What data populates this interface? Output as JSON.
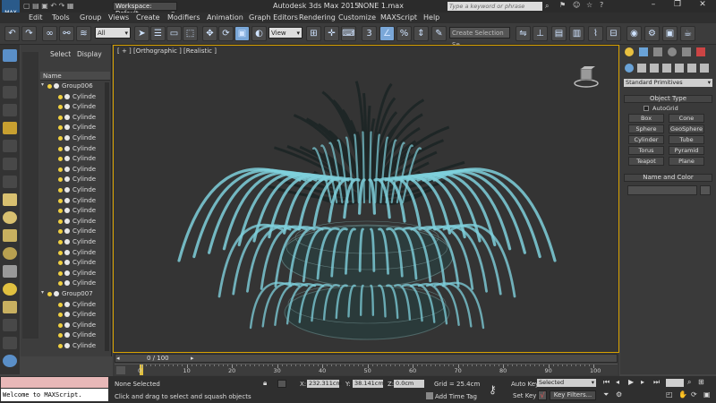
{
  "title": {
    "workspace": "Workspace: Default",
    "app_title": "Autodesk 3ds Max  2015",
    "file_name": "NONE 1.max",
    "search_placeholder": "Type a keyword or phrase"
  },
  "menu": [
    "Edit",
    "Tools",
    "Group",
    "Views",
    "Create",
    "Modifiers",
    "Animation",
    "Graph Editors",
    "Rendering",
    "Customize",
    "MAXScript",
    "Help"
  ],
  "toolbar": {
    "selection_filter": "All",
    "reference_coord": "View",
    "selection_set_placeholder": "Create Selection Se"
  },
  "scene_explorer": {
    "tabs": [
      "Select",
      "Display"
    ],
    "column_header": "Name",
    "items": [
      {
        "label": "Group006",
        "level": 0
      },
      {
        "label": "Cylinde",
        "level": 1
      },
      {
        "label": "Cylinde",
        "level": 1
      },
      {
        "label": "Cylinde",
        "level": 1
      },
      {
        "label": "Cylinde",
        "level": 1
      },
      {
        "label": "Cylinde",
        "level": 1
      },
      {
        "label": "Cylinde",
        "level": 1
      },
      {
        "label": "Cylinde",
        "level": 1
      },
      {
        "label": "Cylinde",
        "level": 1
      },
      {
        "label": "Cylinde",
        "level": 1
      },
      {
        "label": "Cylinde",
        "level": 1
      },
      {
        "label": "Cylinde",
        "level": 1
      },
      {
        "label": "Cylinde",
        "level": 1
      },
      {
        "label": "Cylinde",
        "level": 1
      },
      {
        "label": "Cylinde",
        "level": 1
      },
      {
        "label": "Cylinde",
        "level": 1
      },
      {
        "label": "Cylinde",
        "level": 1
      },
      {
        "label": "Cylinde",
        "level": 1
      },
      {
        "label": "Cylinde",
        "level": 1
      },
      {
        "label": "Cylinde",
        "level": 1
      },
      {
        "label": "Group007",
        "level": 0
      },
      {
        "label": "Cylinde",
        "level": 1
      },
      {
        "label": "Cylinde",
        "level": 1
      },
      {
        "label": "Cylinde",
        "level": 1
      },
      {
        "label": "Cylinde",
        "level": 1
      },
      {
        "label": "Cylinde",
        "level": 1
      },
      {
        "label": "Cylinde",
        "level": 1
      }
    ]
  },
  "viewport": {
    "label": "[ + ] [Orthographic ] [Realistic ]"
  },
  "command_panel": {
    "category": "Standard Primitives",
    "object_type_title": "Object Type",
    "autogrid": "AutoGrid",
    "buttons": [
      "Box",
      "Cone",
      "Sphere",
      "GeoSphere",
      "Cylinder",
      "Tube",
      "Torus",
      "Pyramid",
      "Teapot",
      "Plane"
    ],
    "name_color_title": "Name and Color"
  },
  "timeline": {
    "frame_indicator": "0 / 100",
    "ticks": [
      "0",
      "10",
      "20",
      "30",
      "40",
      "50",
      "60",
      "70",
      "80",
      "90",
      "100"
    ]
  },
  "status": {
    "maxscript_listener": "Welcome to MAXScript.",
    "selection_status": "None Selected",
    "prompt": "Click and drag to select and squash objects",
    "x_label": "X:",
    "x_value": "232.311cm",
    "y_label": "Y:",
    "y_value": "38.141cm",
    "z_label": "Z:",
    "z_value": "0.0cm",
    "grid": "Grid = 25.4cm",
    "add_time_tag": "Add Time Tag",
    "auto_key": "Auto Key",
    "set_key": "Set Key",
    "key_mode": "Selected",
    "key_filters": "Key Filters..."
  },
  "colors": {
    "viewport_border": "#d6a000",
    "tentacle_color": "#7fd0dc",
    "bulb_color": "#f0d040"
  }
}
